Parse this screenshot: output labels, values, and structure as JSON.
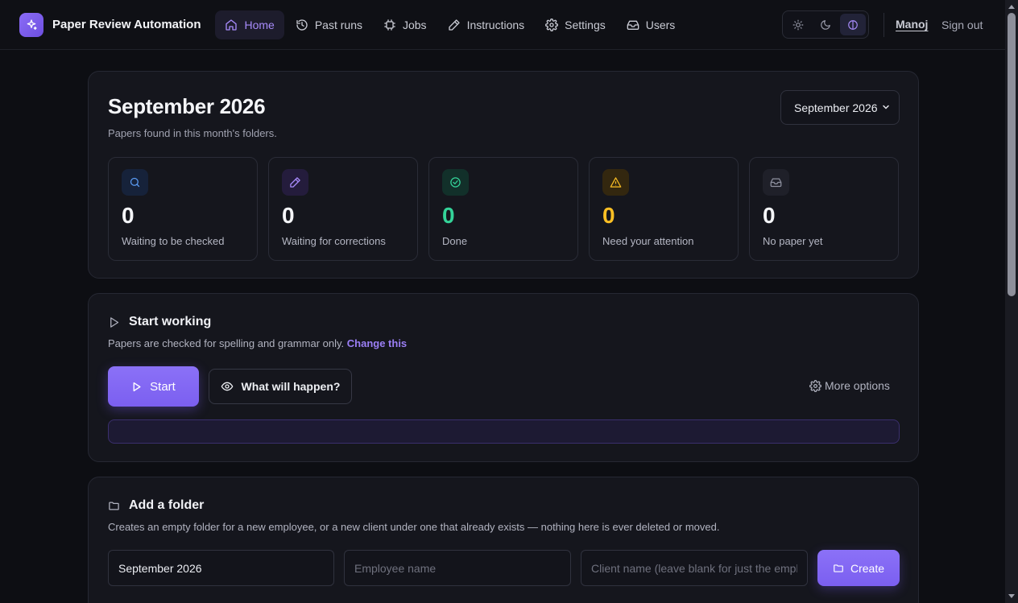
{
  "app": {
    "title": "Paper Review Automation",
    "accent": "#8b6cf6"
  },
  "nav": [
    {
      "label": "Home",
      "icon": "home-icon",
      "active": true
    },
    {
      "label": "Past runs",
      "icon": "history-icon",
      "active": false
    },
    {
      "label": "Jobs",
      "icon": "chip-icon",
      "active": false
    },
    {
      "label": "Instructions",
      "icon": "pencil-icon",
      "active": false
    },
    {
      "label": "Settings",
      "icon": "gear-icon",
      "active": false
    },
    {
      "label": "Users",
      "icon": "inbox-icon",
      "active": false
    }
  ],
  "theme": {
    "options": [
      "light",
      "dark",
      "system"
    ],
    "selected": "system"
  },
  "user": {
    "name": "Manoj",
    "signout_label": "Sign out"
  },
  "month": {
    "title": "September 2026",
    "subtitle": "Papers found in this month's folders.",
    "selected": "September 2026"
  },
  "stats": [
    {
      "value": "0",
      "label": "Waiting to be checked",
      "icon": "search-icon",
      "color": "#f4f5f8",
      "icon_color": "#5b9cf5",
      "icon_bg": "#16223a"
    },
    {
      "value": "0",
      "label": "Waiting for corrections",
      "icon": "pencil-icon",
      "color": "#f4f5f8",
      "icon_color": "#a78bfa",
      "icon_bg": "#241c3c"
    },
    {
      "value": "0",
      "label": "Done",
      "icon": "check-circle-icon",
      "color": "#34d399",
      "icon_color": "#34d399",
      "icon_bg": "#12302a"
    },
    {
      "value": "0",
      "label": "Need your attention",
      "icon": "warning-icon",
      "color": "#fbbf24",
      "icon_color": "#fbbf24",
      "icon_bg": "#33270f"
    },
    {
      "value": "0",
      "label": "No paper yet",
      "icon": "inbox-icon",
      "color": "#f4f5f8",
      "icon_color": "#8f91a0",
      "icon_bg": "#1f2029"
    }
  ],
  "start": {
    "title": "Start working",
    "subtitle": "Papers are checked for spelling and grammar only.",
    "change_link": "Change this",
    "start_label": "Start",
    "preview_label": "What will happen?",
    "more_options_label": "More options",
    "progress": 0
  },
  "folder": {
    "title": "Add a folder",
    "subtitle": "Creates an empty folder for a new employee, or a new client under one that already exists — nothing here is ever deleted or moved.",
    "month_value": "September 2026",
    "employee_placeholder": "Employee name",
    "client_placeholder": "Client name (leave blank for just the employee)",
    "create_label": "Create"
  }
}
